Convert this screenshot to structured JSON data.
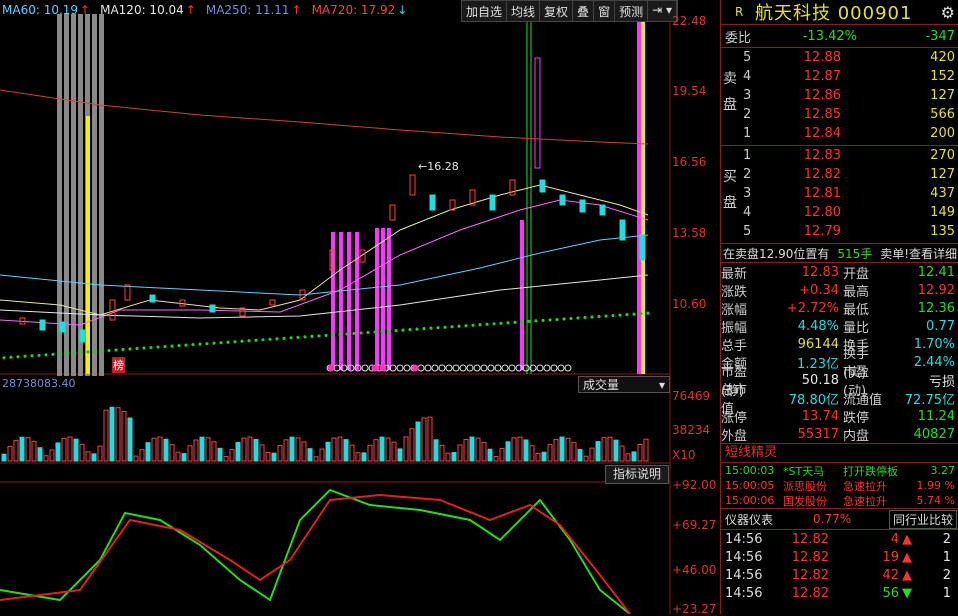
{
  "ma_legend": [
    {
      "label": "MA60: 10.19",
      "arrow": "↑",
      "color": "#60d0ff",
      "arrow_color": "#ff3030"
    },
    {
      "label": "MA120: 10.04",
      "arrow": "↑",
      "color": "#e6e6e6",
      "arrow_color": "#ff3030"
    },
    {
      "label": "MA250: 11.11",
      "arrow": "↑",
      "color": "#7a8cd8",
      "arrow_color": "#ff3030"
    },
    {
      "label": "MA720: 17.92",
      "arrow": "↓",
      "color": "#ff4040",
      "arrow_color": "#22dddd"
    }
  ],
  "toolbar": [
    "加自选",
    "均线",
    "复权",
    "叠",
    "窗",
    "预测"
  ],
  "price_axis": [
    "22.48",
    "19.54",
    "16.56",
    "13.58",
    "10.60"
  ],
  "volume_axis": [
    "76469",
    "38234",
    "X10"
  ],
  "indicator_axis": [
    "+92.00",
    "+69.27",
    "+46.00",
    "+23.27"
  ],
  "volume_left_label": "28738083.40",
  "volume_dropdown": "成交量",
  "indicator_button": "指标说明",
  "chart_annotations": {
    "high_label": "16.28",
    "tag": "榜"
  },
  "stock": {
    "r": "R",
    "name": "航天科技 000901"
  },
  "weibi": {
    "label": "委比",
    "pct": "-13.42%",
    "diff": "-347"
  },
  "sell_label": "卖盘",
  "buy_label": "买盘",
  "sell_orders": [
    {
      "lvl": "5",
      "price": "12.88",
      "vol": "420"
    },
    {
      "lvl": "4",
      "price": "12.87",
      "vol": "152"
    },
    {
      "lvl": "3",
      "price": "12.86",
      "vol": "127"
    },
    {
      "lvl": "2",
      "price": "12.85",
      "vol": "566"
    },
    {
      "lvl": "1",
      "price": "12.84",
      "vol": "200"
    }
  ],
  "buy_orders": [
    {
      "lvl": "1",
      "price": "12.83",
      "vol": "270"
    },
    {
      "lvl": "2",
      "price": "12.82",
      "vol": "127"
    },
    {
      "lvl": "3",
      "price": "12.81",
      "vol": "437"
    },
    {
      "lvl": "4",
      "price": "12.80",
      "vol": "149"
    },
    {
      "lvl": "5",
      "price": "12.79",
      "vol": "135"
    }
  ],
  "sell_note": {
    "text": "在卖盘12.90位置有",
    "vol": "515手",
    "action": "卖单!查看详细"
  },
  "stats": [
    {
      "k": "最新",
      "v": "12.83",
      "vc": "red",
      "k2": "开盘",
      "v2": "12.41",
      "v2c": "green"
    },
    {
      "k": "涨跌",
      "v": "+0.34",
      "vc": "red",
      "k2": "最高",
      "v2": "12.92",
      "v2c": "red"
    },
    {
      "k": "涨幅",
      "v": "+2.72%",
      "vc": "red",
      "k2": "最低",
      "v2": "12.36",
      "v2c": "green"
    },
    {
      "k": "振幅",
      "v": "4.48%",
      "vc": "cyan",
      "k2": "量比",
      "v2": "0.77",
      "v2c": "cyan"
    },
    {
      "k": "总手",
      "v": "96144",
      "vc": "yellow",
      "k2": "换手",
      "v2": "1.70%",
      "v2c": "cyan"
    },
    {
      "k": "金额",
      "v": "1.23亿",
      "vc": "cyan",
      "k2": "换手(实)",
      "v2": "2.44%",
      "v2c": "cyan"
    },
    {
      "k": "市盈(静)",
      "v": "50.18",
      "vc": "white",
      "k2": "市盈(动)",
      "v2": "亏损",
      "v2c": "white"
    },
    {
      "k": "总市值",
      "v": "78.80亿",
      "vc": "cyan",
      "k2": "流通值",
      "v2": "72.75亿",
      "v2c": "cyan"
    },
    {
      "k": "涨停",
      "v": "13.74",
      "vc": "red",
      "k2": "跌停",
      "v2": "11.24",
      "v2c": "green"
    },
    {
      "k": "外盘",
      "v": "55317",
      "vc": "red",
      "k2": "内盘",
      "v2": "40827",
      "v2c": "green"
    }
  ],
  "short_header": "短线精灵",
  "short_items": [
    {
      "time": "15:00:03",
      "name": "*ST天马",
      "event": "打开跌停板",
      "val": "3.27",
      "color": "#22dd22"
    },
    {
      "time": "15:00:05",
      "name": "派思股份",
      "event": "急速拉升",
      "val": "1.99 %",
      "color": "#ff3030"
    },
    {
      "time": "15:00:06",
      "name": "国发股份",
      "event": "急速拉升",
      "val": "5.74 %",
      "color": "#ff3030"
    }
  ],
  "spread": {
    "label": "仪器仪表",
    "pct": "0.77%",
    "peer": "同行业比较"
  },
  "ticks": [
    {
      "t": "14:56",
      "p": "12.82",
      "v": "4",
      "dir": "up",
      "n": "2"
    },
    {
      "t": "14:56",
      "p": "12.82",
      "v": "19",
      "dir": "up",
      "n": "1"
    },
    {
      "t": "14:56",
      "p": "12.82",
      "v": "42",
      "dir": "up",
      "n": "2"
    },
    {
      "t": "14:56",
      "p": "12.82",
      "v": "56",
      "dir": "down",
      "n": "1"
    }
  ]
}
